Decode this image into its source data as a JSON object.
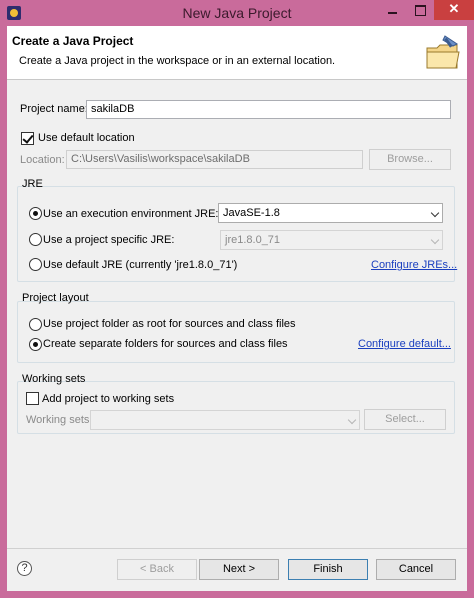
{
  "window": {
    "title": "New Java Project"
  },
  "header": {
    "title": "Create a Java Project",
    "description": "Create a Java project in the workspace or in an external location."
  },
  "project": {
    "name_label": "Project name:",
    "name_value": "sakilaDB",
    "use_default_location_label": "Use default location",
    "use_default_location_checked": true,
    "location_label": "Location:",
    "location_value": "C:\\Users\\Vasilis\\workspace\\sakilaDB",
    "browse_label": "Browse..."
  },
  "jre": {
    "group_title": "JRE",
    "option_env_label": "Use an execution environment JRE:",
    "option_env_value": "JavaSE-1.8",
    "option_specific_label": "Use a project specific JRE:",
    "option_specific_value": "jre1.8.0_71",
    "option_default_label": "Use default JRE (currently 'jre1.8.0_71')",
    "configure_link": "Configure JREs...",
    "selected": "env"
  },
  "layout": {
    "group_title": "Project layout",
    "option_root_label": "Use project folder as root for sources and class files",
    "option_separate_label": "Create separate folders for sources and class files",
    "configure_link": "Configure default...",
    "selected": "separate"
  },
  "working_sets": {
    "group_title": "Working sets",
    "add_label": "Add project to working sets",
    "add_checked": false,
    "sets_label": "Working sets:",
    "select_label": "Select..."
  },
  "footer": {
    "help_symbol": "?",
    "back_label": "< Back",
    "next_label": "Next >",
    "finish_label": "Finish",
    "cancel_label": "Cancel"
  },
  "icons": {
    "app": "eclipse-icon",
    "wizard": "java-project-wizard-icon",
    "help": "help-icon"
  },
  "colors": {
    "title_bar": "#c96b9b",
    "close_button": "#c94040",
    "link": "#1a3fbf"
  }
}
